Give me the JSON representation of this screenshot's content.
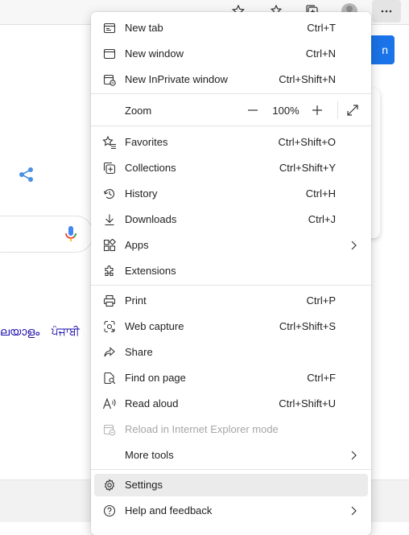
{
  "background": {
    "button_partial_label": "n",
    "languages": [
      "ലയാളം",
      "ਪੰਜਾਬੀ"
    ]
  },
  "menu": {
    "items_top": [
      {
        "label": "New tab",
        "shortcut": "Ctrl+T",
        "icon": "new-tab-icon"
      },
      {
        "label": "New window",
        "shortcut": "Ctrl+N",
        "icon": "new-window-icon"
      },
      {
        "label": "New InPrivate window",
        "shortcut": "Ctrl+Shift+N",
        "icon": "inprivate-icon"
      }
    ],
    "zoom": {
      "label": "Zoom",
      "value": "100%",
      "minus": "—",
      "plus": "+"
    },
    "items_mid": [
      {
        "label": "Favorites",
        "shortcut": "Ctrl+Shift+O",
        "icon": "favorites-icon"
      },
      {
        "label": "Collections",
        "shortcut": "Ctrl+Shift+Y",
        "icon": "collections-icon"
      },
      {
        "label": "History",
        "shortcut": "Ctrl+H",
        "icon": "history-icon"
      },
      {
        "label": "Downloads",
        "shortcut": "Ctrl+J",
        "icon": "download-icon"
      },
      {
        "label": "Apps",
        "shortcut": "",
        "icon": "apps-icon"
      },
      {
        "label": "Extensions",
        "shortcut": "",
        "icon": "extensions-icon"
      }
    ],
    "items_tools": [
      {
        "label": "Print",
        "shortcut": "Ctrl+P",
        "icon": "print-icon"
      },
      {
        "label": "Web capture",
        "shortcut": "Ctrl+Shift+S",
        "icon": "web-capture-icon"
      },
      {
        "label": "Share",
        "shortcut": "",
        "icon": "share-icon"
      },
      {
        "label": "Find on page",
        "shortcut": "Ctrl+F",
        "icon": "find-icon"
      },
      {
        "label": "Read aloud",
        "shortcut": "Ctrl+Shift+U",
        "icon": "read-aloud-icon"
      },
      {
        "label": "Reload in Internet Explorer mode",
        "shortcut": "",
        "icon": "ie-mode-icon"
      },
      {
        "label": "More tools",
        "shortcut": "",
        "icon": ""
      }
    ],
    "items_bottom": [
      {
        "label": "Settings",
        "shortcut": "",
        "icon": "gear-icon"
      },
      {
        "label": "Help and feedback",
        "shortcut": "",
        "icon": "help-icon"
      }
    ]
  }
}
